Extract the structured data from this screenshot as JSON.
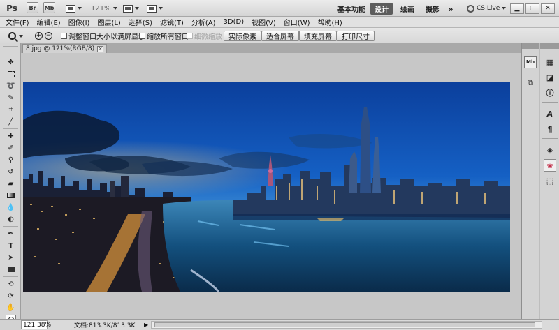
{
  "app": {
    "logo": "Ps",
    "bridge": "Br",
    "minibridge": "Mb",
    "zoom_level": "121%"
  },
  "workspaces": [
    "基本功能",
    "设计",
    "绘画",
    "摄影"
  ],
  "workspace_more": "»",
  "cs_live": "CS Live",
  "menu": [
    "文件(F)",
    "编辑(E)",
    "图像(I)",
    "图层(L)",
    "选择(S)",
    "滤镜(T)",
    "分析(A)",
    "3D(D)",
    "视图(V)",
    "窗口(W)",
    "帮助(H)"
  ],
  "options": {
    "resize_windows": "调整窗口大小以满屏显示",
    "zoom_all_windows": "缩放所有窗口",
    "scrubby_zoom": "细微缩放",
    "buttons": [
      "实际像素",
      "适合屏幕",
      "填充屏幕",
      "打印尺寸"
    ]
  },
  "document": {
    "tab_title": "8.jpg @ 121%(RGB/8)",
    "close_symbol": "×"
  },
  "status": {
    "zoom": "121.38%",
    "doc_info": "文档:813.3K/813.3K",
    "arrow": "▶"
  },
  "colors": {
    "accent_workspace": "#5d5d5d",
    "panel_bg": "#d6d6d6",
    "canvas_bg": "#c7c7c7"
  },
  "icons": {
    "tools": [
      "move-icon",
      "marquee-icon",
      "lasso-icon",
      "quick-select-icon",
      "crop-icon",
      "eyedropper-icon",
      "healing-brush-icon",
      "brush-icon",
      "clone-stamp-icon",
      "history-brush-icon",
      "eraser-icon",
      "gradient-icon",
      "blur-icon",
      "dodge-icon",
      "pen-icon",
      "type-icon",
      "path-select-icon",
      "shape-icon",
      "3d-rotate-icon",
      "3d-orbit-icon",
      "hand-icon",
      "zoom-icon",
      "foreground-color-swatch",
      "background-color-swatch",
      "quick-mask-icon",
      "screen-mode-icon"
    ],
    "dock": [
      "minibridge-panel-icon",
      "history-panel-icon",
      "actions-panel-icon",
      "histogram-panel-icon",
      "navigator-panel-icon",
      "info-panel-icon",
      "character-panel-icon",
      "paragraph-panel-icon",
      "layers-panel-icon",
      "channels-panel-icon",
      "paths-panel-icon"
    ]
  }
}
